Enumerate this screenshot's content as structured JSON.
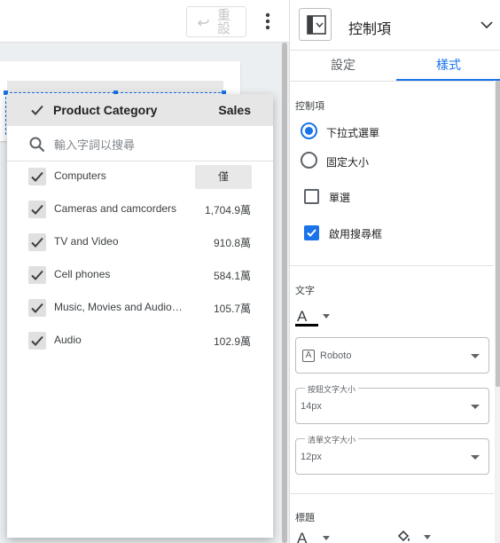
{
  "toolbar": {
    "redo_label": "重設",
    "more_icon": "more-vert-icon"
  },
  "dropdown": {
    "header_dimension": "Product Category",
    "header_metric": "Sales",
    "search_placeholder": "輸入字詞以搜尋",
    "only_button_label": "僅",
    "rows": [
      {
        "name": "Computers",
        "value": ""
      },
      {
        "name": "Cameras and camcorders",
        "value": "1,704.9萬"
      },
      {
        "name": "TV and Video",
        "value": "910.8萬"
      },
      {
        "name": "Cell phones",
        "value": "584.1萬"
      },
      {
        "name": "Music, Movies and Audio Books",
        "value": "105.7萬"
      },
      {
        "name": "Audio",
        "value": "102.9萬"
      }
    ]
  },
  "panel": {
    "title": "控制項",
    "tabs": {
      "setup": "設定",
      "style": "樣式"
    },
    "control_section": "控制項",
    "radio_dropdown": "下拉式選單",
    "radio_fixed": "固定大小",
    "single_select": "單選",
    "enable_search": "啟用搜尋框",
    "text_section": "文字",
    "font_value": "Roboto",
    "button_font_size_label": "按鈕文字大小",
    "button_font_size": "14px",
    "list_font_size_label": "清單文字大小",
    "list_font_size": "12px",
    "title_section": "標題"
  },
  "colors": {
    "accent": "#1a73e8",
    "header_grey": "#e6e6e6",
    "checkbox_grey": "#e0e0e0"
  }
}
